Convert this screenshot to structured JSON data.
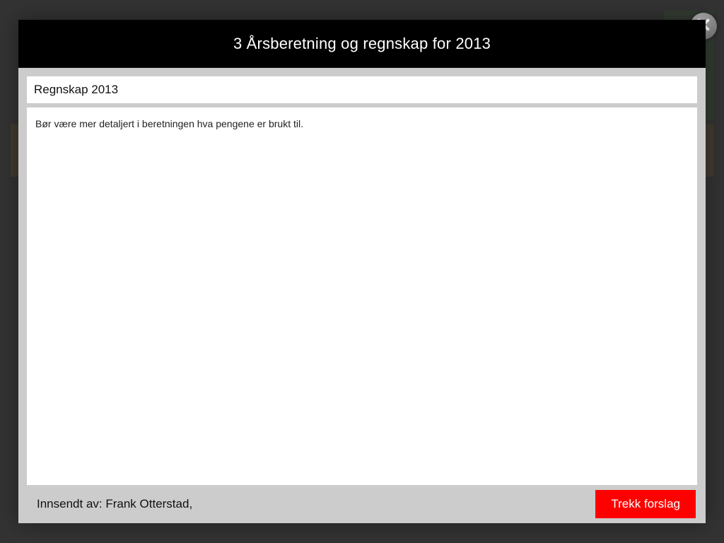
{
  "modal": {
    "title": "3 Årsberetning og regnskap for 2013",
    "section_title": "Regnskap 2013",
    "body_text": "Bør være mer detaljert i beretningen hva pengene er brukt til.",
    "submitted_by": "Innsendt av: Frank Otterstad,",
    "withdraw_label": "Trekk forslag"
  }
}
